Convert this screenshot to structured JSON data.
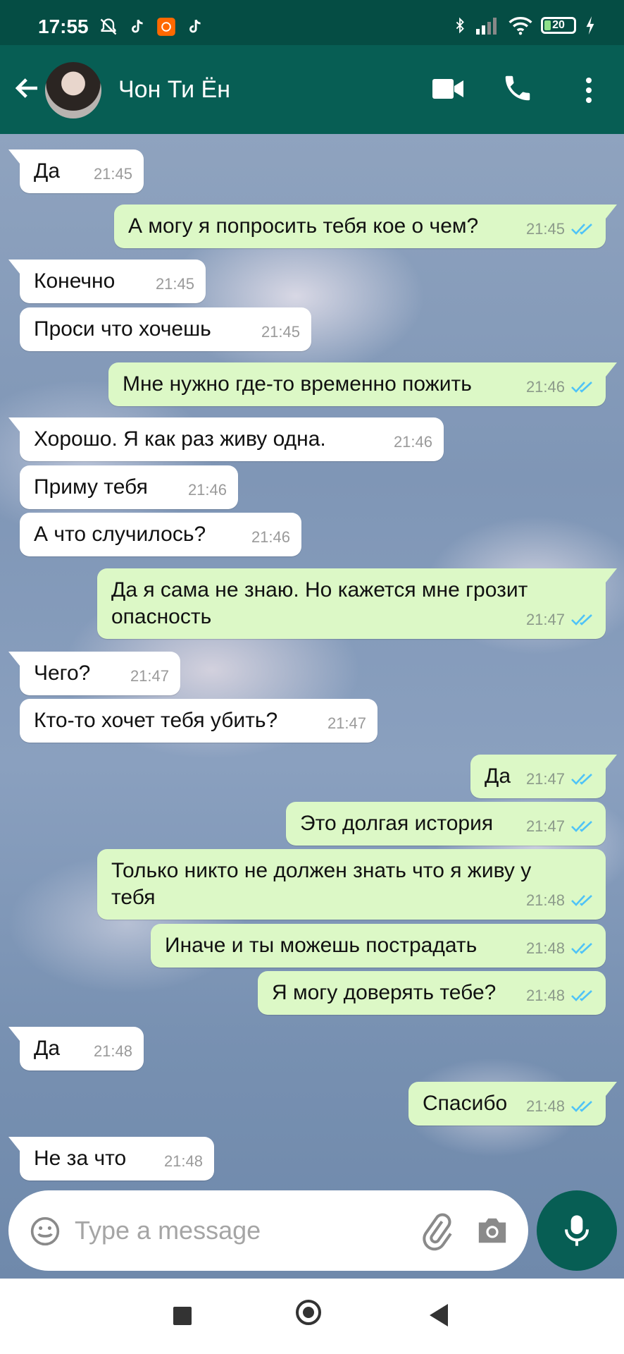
{
  "status_bar": {
    "time": "17:55",
    "battery": "20"
  },
  "header": {
    "contact_name": "Чон Ти Ён"
  },
  "messages": [
    {
      "dir": "in",
      "text": "Да",
      "time": "21:45"
    },
    {
      "dir": "out",
      "text": "А могу я попросить тебя кое о чем?",
      "time": "21:45"
    },
    {
      "dir": "in",
      "text": "Конечно",
      "time": "21:45"
    },
    {
      "dir": "in",
      "text": "Проси что хочешь",
      "time": "21:45"
    },
    {
      "dir": "out",
      "text": "Мне нужно где-то временно пожить",
      "time": "21:46"
    },
    {
      "dir": "in",
      "text": "Хорошо. Я как раз живу одна.",
      "time": "21:46"
    },
    {
      "dir": "in",
      "text": "Приму тебя",
      "time": "21:46"
    },
    {
      "dir": "in",
      "text": "А что случилось?",
      "time": "21:46"
    },
    {
      "dir": "out",
      "text": "Да я сама не знаю. Но кажется мне грозит опасность",
      "time": "21:47"
    },
    {
      "dir": "in",
      "text": "Чего?",
      "time": "21:47"
    },
    {
      "dir": "in",
      "text": "Кто-то хочет тебя убить?",
      "time": "21:47"
    },
    {
      "dir": "out",
      "text": "Да",
      "time": "21:47"
    },
    {
      "dir": "out",
      "text": "Это долгая история",
      "time": "21:47"
    },
    {
      "dir": "out",
      "text": "Только никто не должен знать что я живу у тебя",
      "time": "21:48"
    },
    {
      "dir": "out",
      "text": "Иначе и ты можешь пострадать",
      "time": "21:48"
    },
    {
      "dir": "out",
      "text": "Я могу доверять тебе?",
      "time": "21:48"
    },
    {
      "dir": "in",
      "text": "Да",
      "time": "21:48"
    },
    {
      "dir": "out",
      "text": "Спасибо",
      "time": "21:48"
    },
    {
      "dir": "in",
      "text": "Не за что",
      "time": "21:48"
    }
  ],
  "composer": {
    "placeholder": "Type a message"
  },
  "colors": {
    "header": "#075e54",
    "status_bar": "#054d44",
    "outgoing": "#dcf8c6",
    "incoming": "#ffffff",
    "read_ticks": "#4fc3f7"
  }
}
